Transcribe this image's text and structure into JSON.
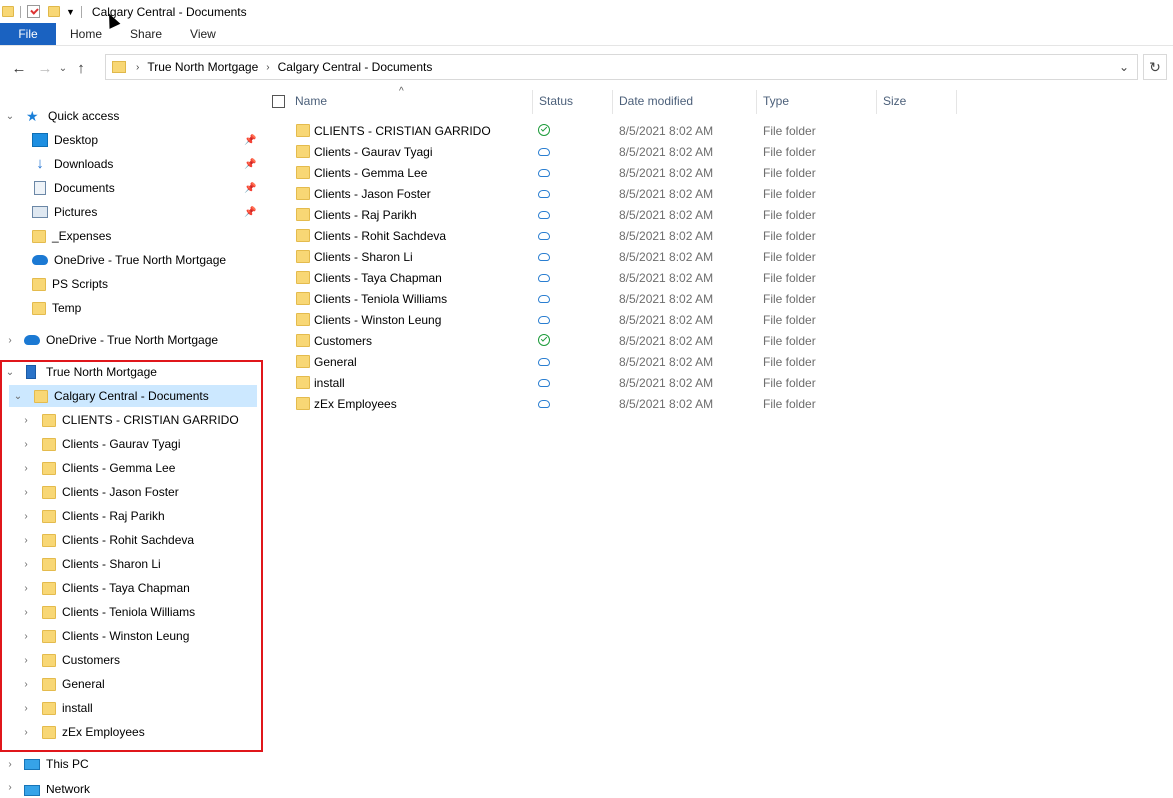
{
  "window": {
    "title": "Calgary Central - Documents"
  },
  "ribbon": {
    "tabs": [
      "File",
      "Home",
      "Share",
      "View"
    ]
  },
  "address": {
    "crumbs": [
      "True North Mortgage",
      "Calgary Central - Documents"
    ]
  },
  "navpane": {
    "quick_access": "Quick access",
    "quick_items": [
      {
        "label": "Desktop",
        "pinned": true
      },
      {
        "label": "Downloads",
        "pinned": true
      },
      {
        "label": "Documents",
        "pinned": true
      },
      {
        "label": "Pictures",
        "pinned": true
      },
      {
        "label": "_Expenses",
        "pinned": false
      },
      {
        "label": "OneDrive - True North Mortgage",
        "pinned": false
      },
      {
        "label": "PS Scripts",
        "pinned": false
      },
      {
        "label": "Temp",
        "pinned": false
      }
    ],
    "onedrive": "OneDrive - True North Mortgage",
    "org": "True North Mortgage",
    "library": "Calgary Central - Documents",
    "subfolders": [
      "CLIENTS - CRISTIAN GARRIDO",
      "Clients - Gaurav Tyagi",
      "Clients - Gemma Lee",
      "Clients - Jason Foster",
      "Clients - Raj Parikh",
      "Clients - Rohit Sachdeva",
      "Clients - Sharon Li",
      "Clients - Taya Chapman",
      "Clients - Teniola Williams",
      "Clients - Winston Leung",
      "Customers",
      "General",
      "install",
      "zEx Employees"
    ],
    "this_pc": "This PC",
    "network": "Network"
  },
  "columns": [
    "Name",
    "Status",
    "Date modified",
    "Type",
    "Size"
  ],
  "files": [
    {
      "name": "CLIENTS - CRISTIAN GARRIDO",
      "status": "synced",
      "date": "8/5/2021 8:02 AM",
      "type": "File folder"
    },
    {
      "name": "Clients - Gaurav Tyagi",
      "status": "cloud",
      "date": "8/5/2021 8:02 AM",
      "type": "File folder"
    },
    {
      "name": "Clients - Gemma Lee",
      "status": "cloud",
      "date": "8/5/2021 8:02 AM",
      "type": "File folder"
    },
    {
      "name": "Clients - Jason Foster",
      "status": "cloud",
      "date": "8/5/2021 8:02 AM",
      "type": "File folder"
    },
    {
      "name": "Clients - Raj Parikh",
      "status": "cloud",
      "date": "8/5/2021 8:02 AM",
      "type": "File folder"
    },
    {
      "name": "Clients - Rohit Sachdeva",
      "status": "cloud",
      "date": "8/5/2021 8:02 AM",
      "type": "File folder"
    },
    {
      "name": "Clients - Sharon Li",
      "status": "cloud",
      "date": "8/5/2021 8:02 AM",
      "type": "File folder"
    },
    {
      "name": "Clients - Taya Chapman",
      "status": "cloud",
      "date": "8/5/2021 8:02 AM",
      "type": "File folder"
    },
    {
      "name": "Clients - Teniola Williams",
      "status": "cloud",
      "date": "8/5/2021 8:02 AM",
      "type": "File folder"
    },
    {
      "name": "Clients - Winston Leung",
      "status": "cloud",
      "date": "8/5/2021 8:02 AM",
      "type": "File folder"
    },
    {
      "name": "Customers",
      "status": "synced",
      "date": "8/5/2021 8:02 AM",
      "type": "File folder"
    },
    {
      "name": "General",
      "status": "cloud",
      "date": "8/5/2021 8:02 AM",
      "type": "File folder"
    },
    {
      "name": "install",
      "status": "cloud",
      "date": "8/5/2021 8:02 AM",
      "type": "File folder"
    },
    {
      "name": "zEx Employees",
      "status": "cloud",
      "date": "8/5/2021 8:02 AM",
      "type": "File folder"
    }
  ],
  "colors": {
    "accent": "#1a62c1",
    "selection": "#cce8ff",
    "highlight_border": "#e0161b",
    "folder": "#f8d775"
  }
}
